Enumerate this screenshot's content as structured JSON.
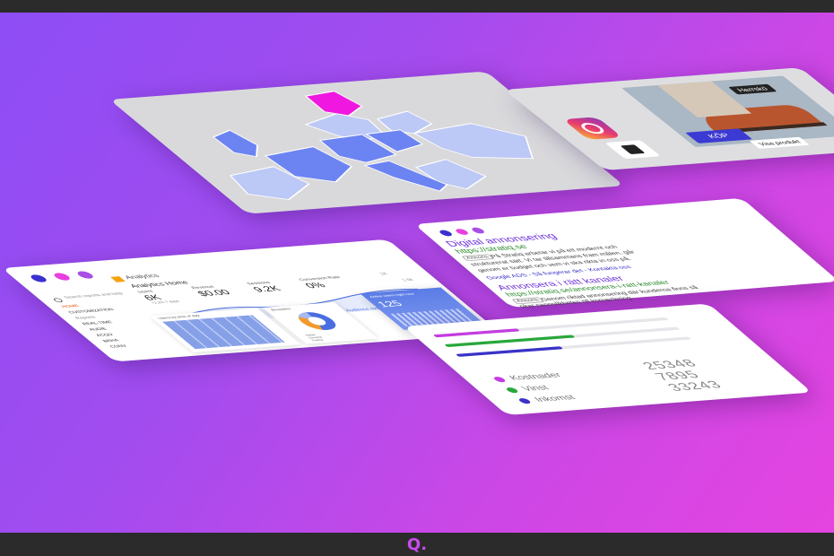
{
  "brand": {
    "logo_text": "Q."
  },
  "colors": {
    "bg_start": "#8e4df5",
    "bg_end": "#e544e0",
    "dot_blue": "#3a2fd0",
    "dot_pink": "#e83fe0",
    "dot_purple": "#a84fe6",
    "map_highlight": "#f018e0",
    "map_blue": "#6c84f2",
    "map_light": "#bcc8f5",
    "link_green": "#2a8a2a",
    "title_purple": "#6b2fd8"
  },
  "map_card": {
    "region_icon": "europe-map-icon"
  },
  "insta_card": {
    "buy_label": "KÖP",
    "tag_label": "Herrskö",
    "view_label": "Visa produkt",
    "icons": [
      "instagram-icon",
      "shopping-bag-icon"
    ]
  },
  "analytics": {
    "logo_label": "Analytics",
    "home_label": "Analytics Home",
    "search_placeholder": "Search reports and help",
    "nav": [
      "HOME",
      "CUSTOMIZATION",
      "Reports",
      "REAL-TIME",
      "AUDIE",
      "ACQU",
      "BEHA",
      "CONV"
    ],
    "metrics": [
      {
        "label": "Users",
        "value": "6K",
        "sub": "+1.2% 7 days"
      },
      {
        "label": "Revenue",
        "value": "$0.00",
        "sub": ""
      },
      {
        "label": "Sessions",
        "value": "9.2K",
        "sub": ""
      },
      {
        "label": "Conversion Rate",
        "value": "0%",
        "sub": ""
      }
    ],
    "axis_right": [
      "1K",
      "1.5k",
      "1k"
    ],
    "heatmap_title": "Users by time of day",
    "browsers_title": "Browsers",
    "browser_legend": [
      "Safari",
      "Chrome",
      "Firefox"
    ],
    "active_users_label": "Active users right now",
    "active_users_value": "125",
    "audience_label": "Audience overview"
  },
  "ads": {
    "ad1_title": "Digital annonsering",
    "ad1_url": "https://stratiq.se",
    "ad_badge": "Annons",
    "ad1_desc1": "På Stratiq arbetar vi på ett modernt och",
    "ad1_desc2": "strukturerat sätt. Vi tar tillsammans fram målen, går",
    "ad1_desc3": "genom er budget och vem vi ska rikta in oss på.",
    "ad1_sitelinks": "Google ADS - Så fungerar det - Kontakta oss",
    "ad2_title": "Annonsera i rätt kanaler",
    "ad2_url": "https://stratiq.se/annonsera-i-ratt-kanaler",
    "ad2_desc1": "Genom riktad annonsering där kunderna finns så",
    "ad2_desc2": "ökar sannolikheten till konvertering."
  },
  "stats": {
    "rows": [
      {
        "label": "Kostnader",
        "value": "25348",
        "color": "#c43de0",
        "fill": 0.36
      },
      {
        "label": "Vinst",
        "value": "7895",
        "color": "#27a83a",
        "fill": 0.55
      },
      {
        "label": "Inkomst",
        "value": "33243",
        "color": "#3b32c8",
        "fill": 0.45
      }
    ]
  }
}
